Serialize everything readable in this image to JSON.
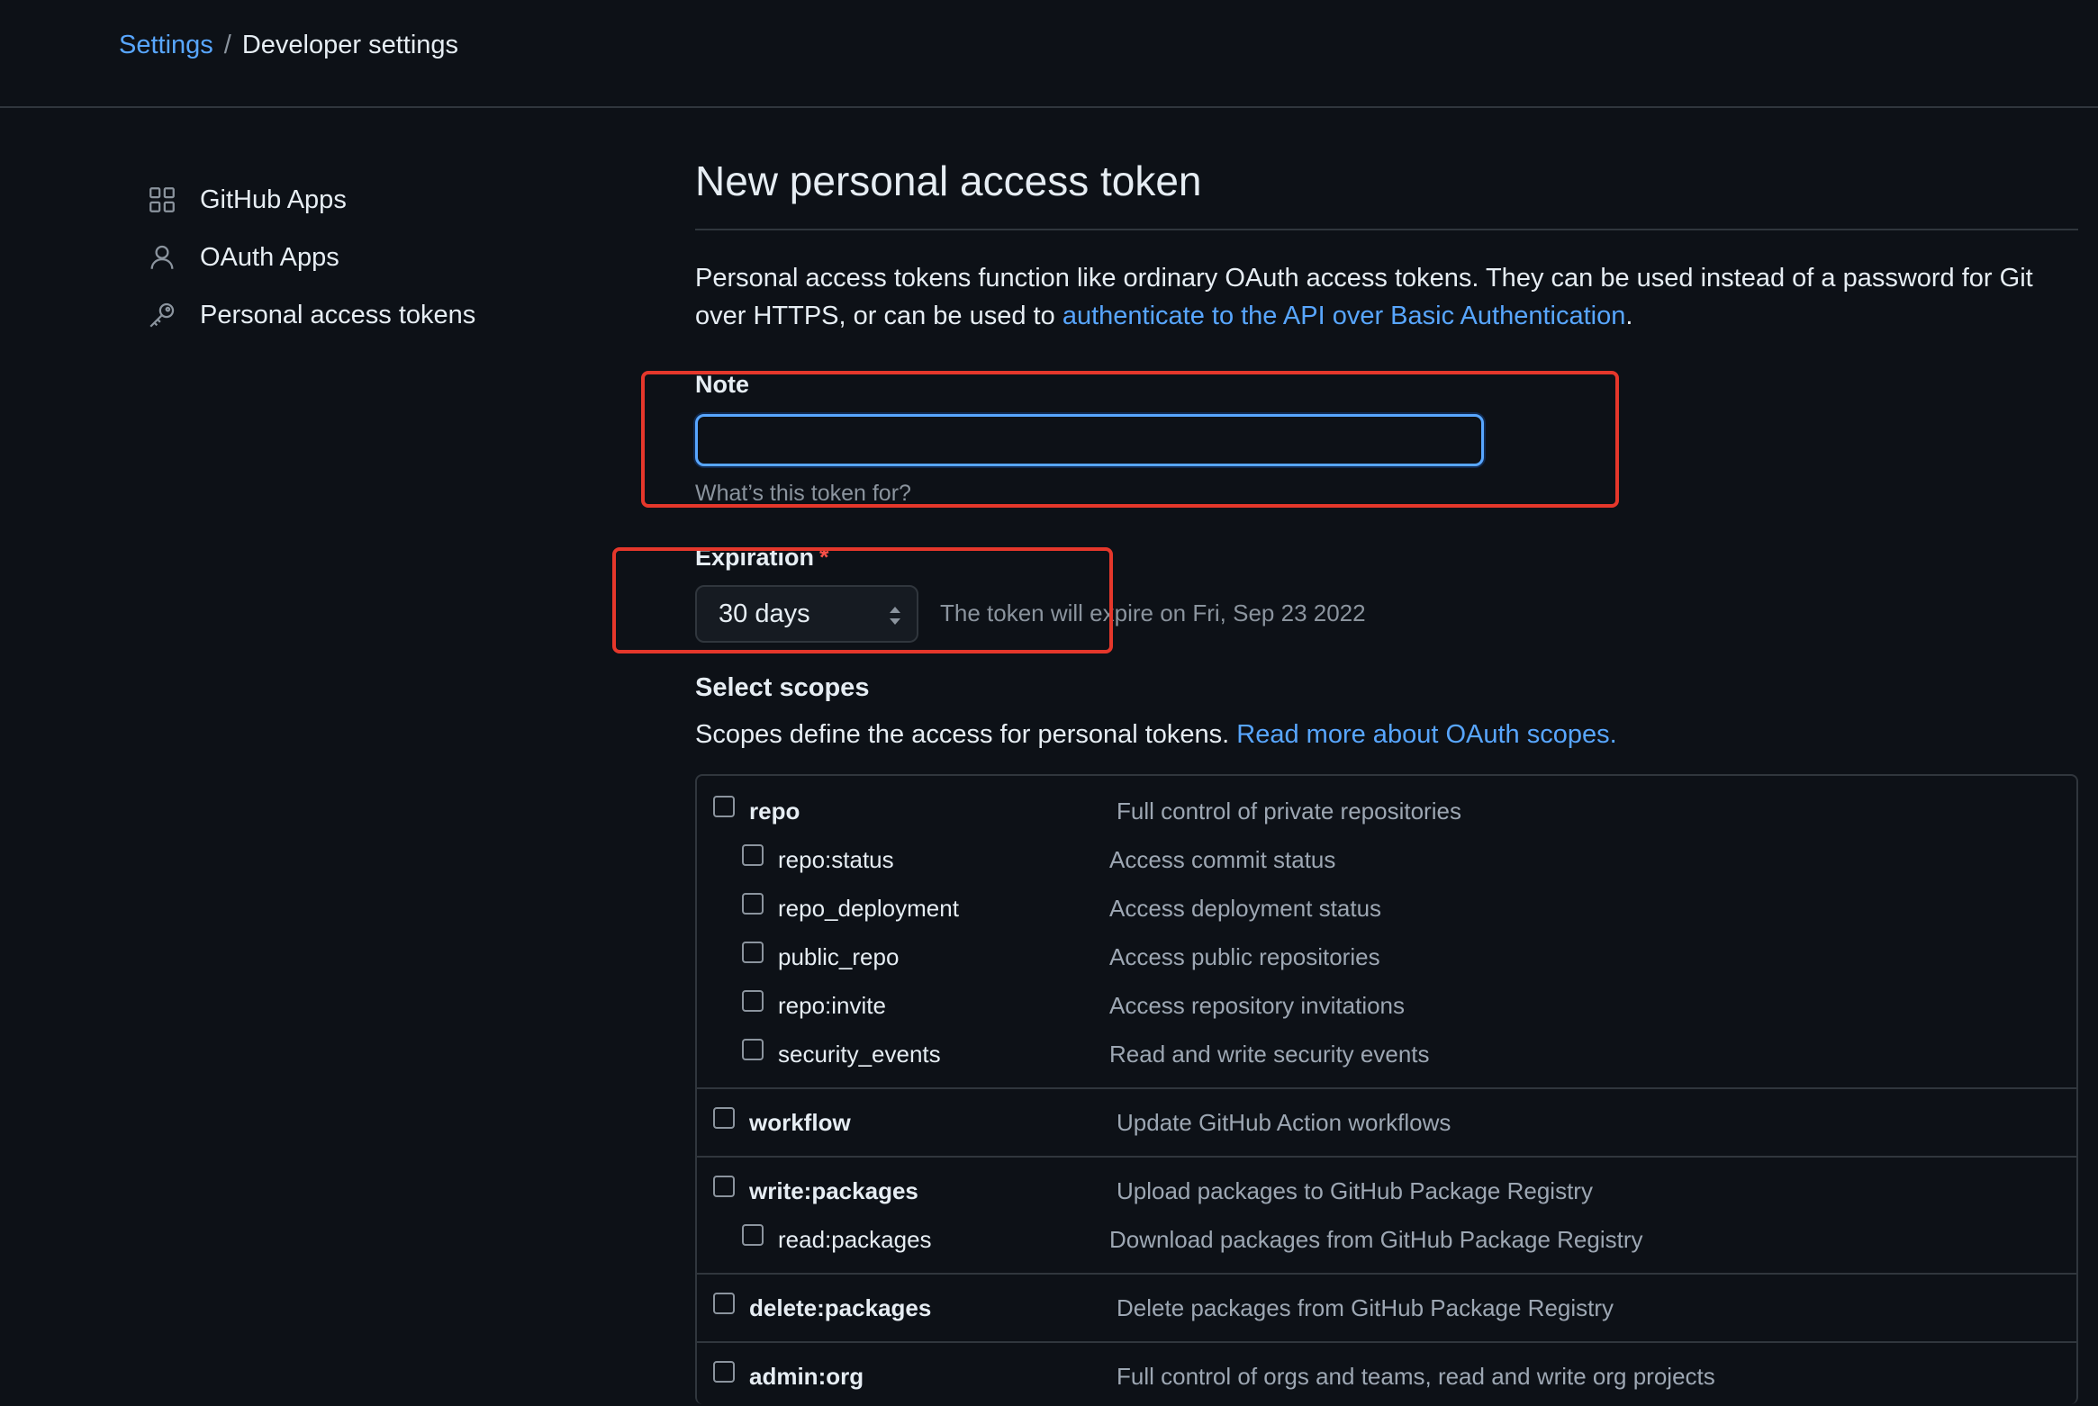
{
  "breadcrumb": {
    "settings": "Settings",
    "separator": "/",
    "current": "Developer settings"
  },
  "sidebar": {
    "items": [
      {
        "label": "GitHub Apps",
        "icon": "apps-grid-icon"
      },
      {
        "label": "OAuth Apps",
        "icon": "person-icon"
      },
      {
        "label": "Personal access tokens",
        "icon": "key-icon"
      }
    ]
  },
  "main": {
    "title": "New personal access token",
    "intro_text": "Personal access tokens function like ordinary OAuth access tokens. They can be used instead of a password for Git over HTTPS, or can be used to ",
    "intro_link": "authenticate to the API over Basic Authentication",
    "intro_end": "."
  },
  "note": {
    "label": "Note",
    "value": "",
    "hint": "What’s this token for?"
  },
  "expiration": {
    "label": "Expiration",
    "required_mark": "*",
    "selected": "30 days",
    "expire_text": "The token will expire on Fri, Sep 23 2022"
  },
  "scopes": {
    "title": "Select scopes",
    "desc": "Scopes define the access for personal tokens. ",
    "desc_link": "Read more about OAuth scopes.",
    "rows": [
      {
        "name": "repo",
        "desc": "Full control of private repositories"
      },
      {
        "name": "repo:status",
        "desc": "Access commit status"
      },
      {
        "name": "repo_deployment",
        "desc": "Access deployment status"
      },
      {
        "name": "public_repo",
        "desc": "Access public repositories"
      },
      {
        "name": "repo:invite",
        "desc": "Access repository invitations"
      },
      {
        "name": "security_events",
        "desc": "Read and write security events"
      },
      {
        "name": "workflow",
        "desc": "Update GitHub Action workflows"
      },
      {
        "name": "write:packages",
        "desc": "Upload packages to GitHub Package Registry"
      },
      {
        "name": "read:packages",
        "desc": "Download packages from GitHub Package Registry"
      },
      {
        "name": "delete:packages",
        "desc": "Delete packages from GitHub Package Registry"
      },
      {
        "name": "admin:org",
        "desc": "Full control of orgs and teams, read and write org projects"
      }
    ]
  },
  "colors": {
    "background": "#0d1117",
    "link": "#58a6ff",
    "border": "#30363d",
    "annotation_red": "#e5372b"
  }
}
